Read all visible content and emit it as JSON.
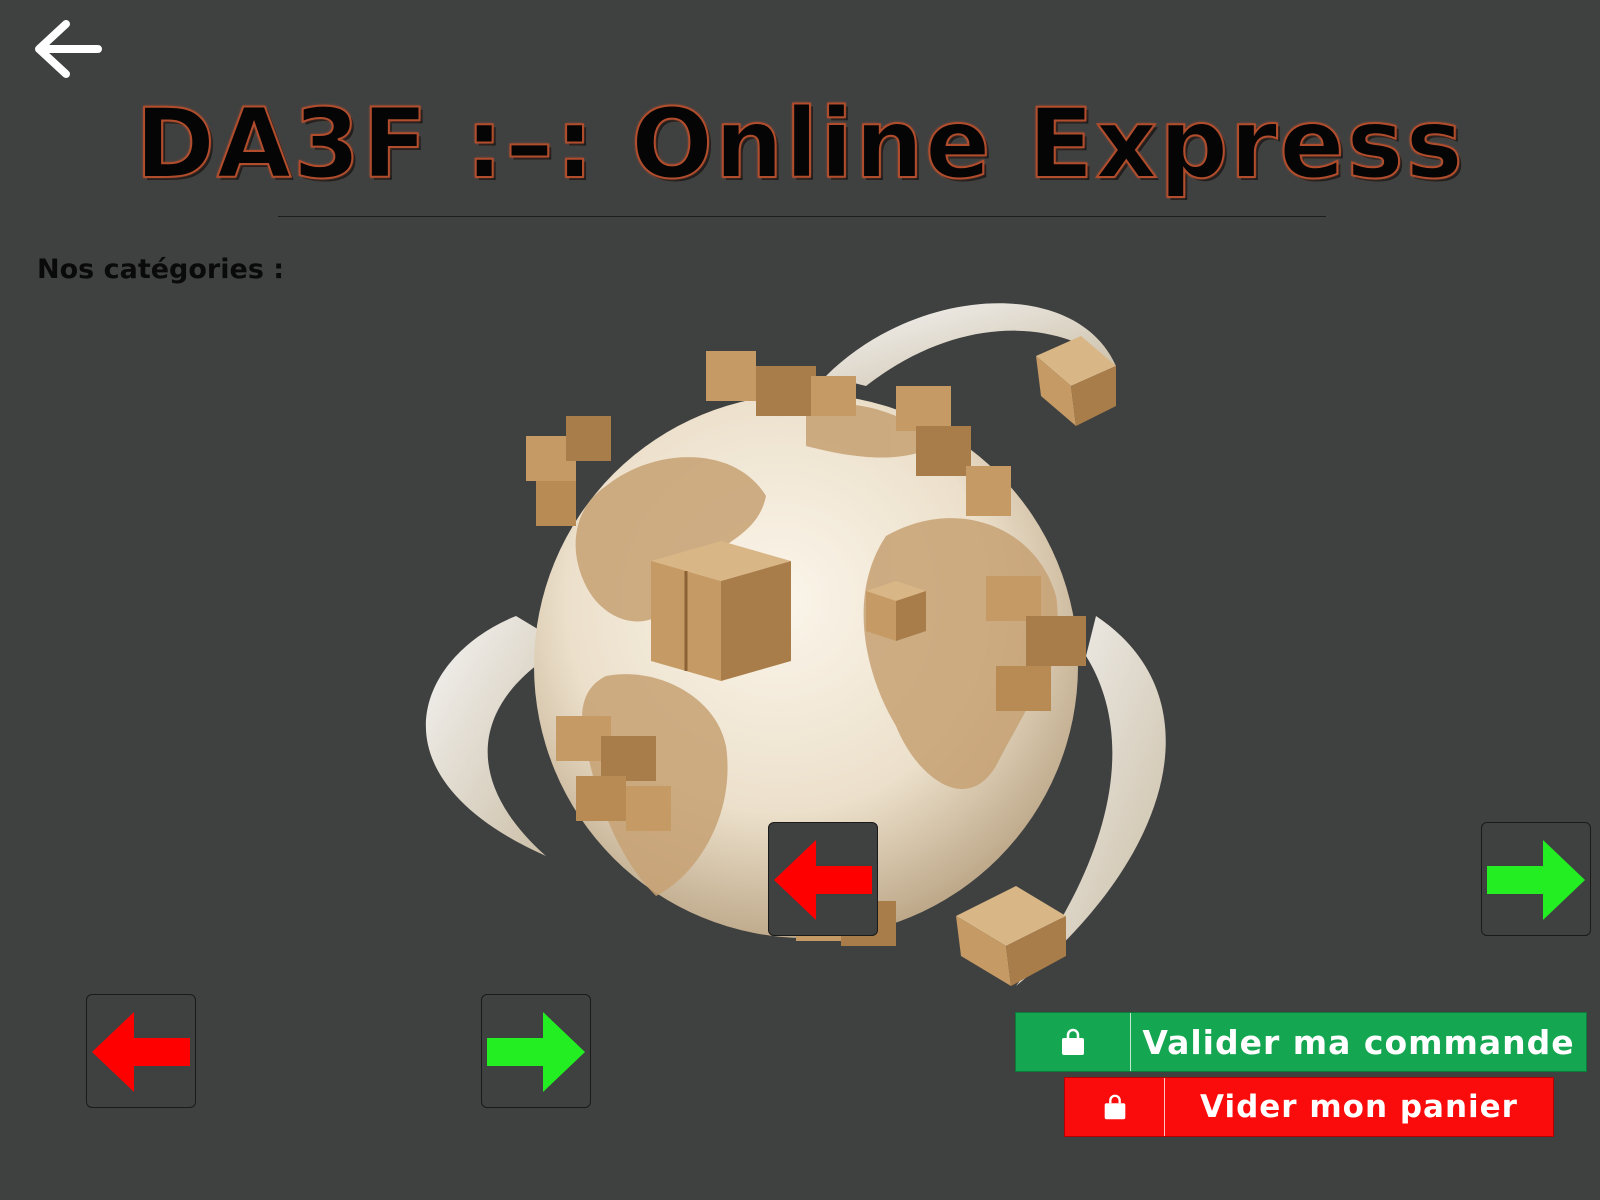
{
  "header": {
    "back_icon": "arrow-left-icon",
    "title": "DA3F :–: Online Express"
  },
  "categories": {
    "label": "Nos catégories :"
  },
  "hero": {
    "image": "globe-with-cardboard-boxes"
  },
  "navigation": {
    "prev_icon": "arrow-left-icon",
    "next_icon": "arrow-right-icon",
    "prev_color": "#ff0000",
    "next_color": "#22ee22"
  },
  "cart": {
    "validate_label": "Valider ma commande",
    "validate_color": "#14a650",
    "empty_label": "Vider mon panier",
    "empty_color": "#fb0c0c",
    "icon": "shopping-bag-icon"
  }
}
